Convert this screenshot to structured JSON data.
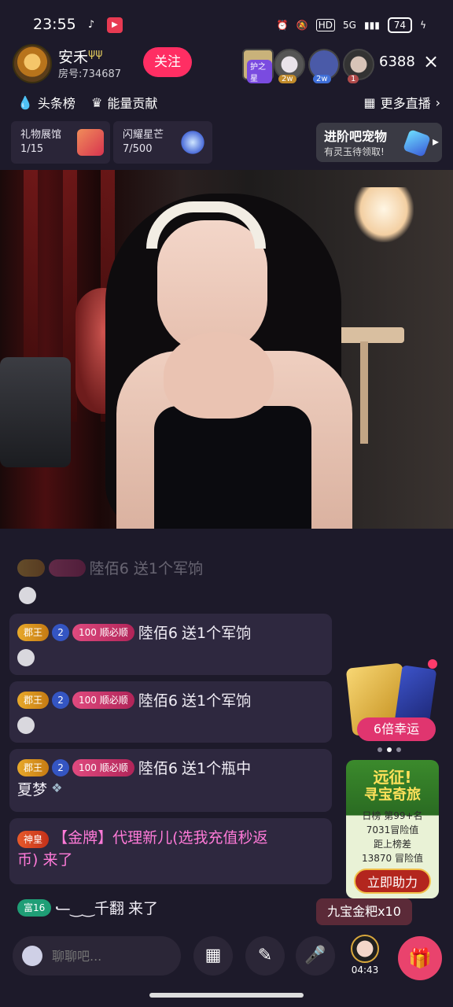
{
  "status_bar": {
    "time": "23:55",
    "network": "5G",
    "battery": "74"
  },
  "header": {
    "anchor_name": "安禾",
    "room_number": "房号:734687",
    "follow_label": "关注",
    "viewers": [
      {
        "tag": "护之星"
      },
      {
        "tag": "2w"
      },
      {
        "tag": "2w"
      },
      {
        "tag": "1"
      }
    ],
    "viewer_count": "6388",
    "close_icon": "×"
  },
  "rank_row": {
    "headline_label": "头条榜",
    "energy_label": "能量贡献",
    "more_live_label": "更多直播"
  },
  "gift_row": {
    "gallery_label": "礼物展馆",
    "gallery_value": "1/15",
    "shine_label": "闪耀星芒",
    "shine_value": "7/500",
    "promo_title": "进阶吧宠物",
    "promo_sub": "有灵玉待领取!"
  },
  "chat": {
    "messages": [
      {
        "badge1": "郡王",
        "badge2": "2",
        "badge3": "100 顺必顺",
        "user": "陸佰6",
        "text": "送1个军饷"
      },
      {
        "badge1": "郡王",
        "badge2": "2",
        "badge3": "100 顺必顺",
        "user": "陸佰6",
        "text": "送1个军饷"
      },
      {
        "badge1": "郡王",
        "badge2": "2",
        "badge3": "100 顺必顺",
        "user": "陸佰6",
        "text": "送1个瓶中",
        "text2": "夏梦"
      },
      {
        "badge1": "神皇",
        "gold_label": "【金牌】代理新儿(选我充值秒返",
        "gold_label2": "币) 来了"
      },
      {
        "badge1": "富16",
        "user": "⹃‿‿千翻",
        "text": "来了"
      }
    ],
    "faded_text": "陸佰6 送1个军饷"
  },
  "side": {
    "lucky_label": "6倍幸运",
    "quest_title": "远征!",
    "quest_title2": "寻宝奇旅",
    "quest_rank": "日榜 第99+名",
    "quest_value": "7031冒险值",
    "quest_gap_label": "距上榜差",
    "quest_gap_value": "13870 冒险值",
    "quest_help_label": "立即助力",
    "gift_toast": "九宝金粑x10"
  },
  "bottom": {
    "chat_placeholder": "聊聊吧...",
    "timer": "04:43"
  },
  "colors": {
    "background": "#1d1a2a",
    "follow": "#ff2e63",
    "gift_button": "#e9436d",
    "chat_gold_text": "#ff7ad8"
  }
}
